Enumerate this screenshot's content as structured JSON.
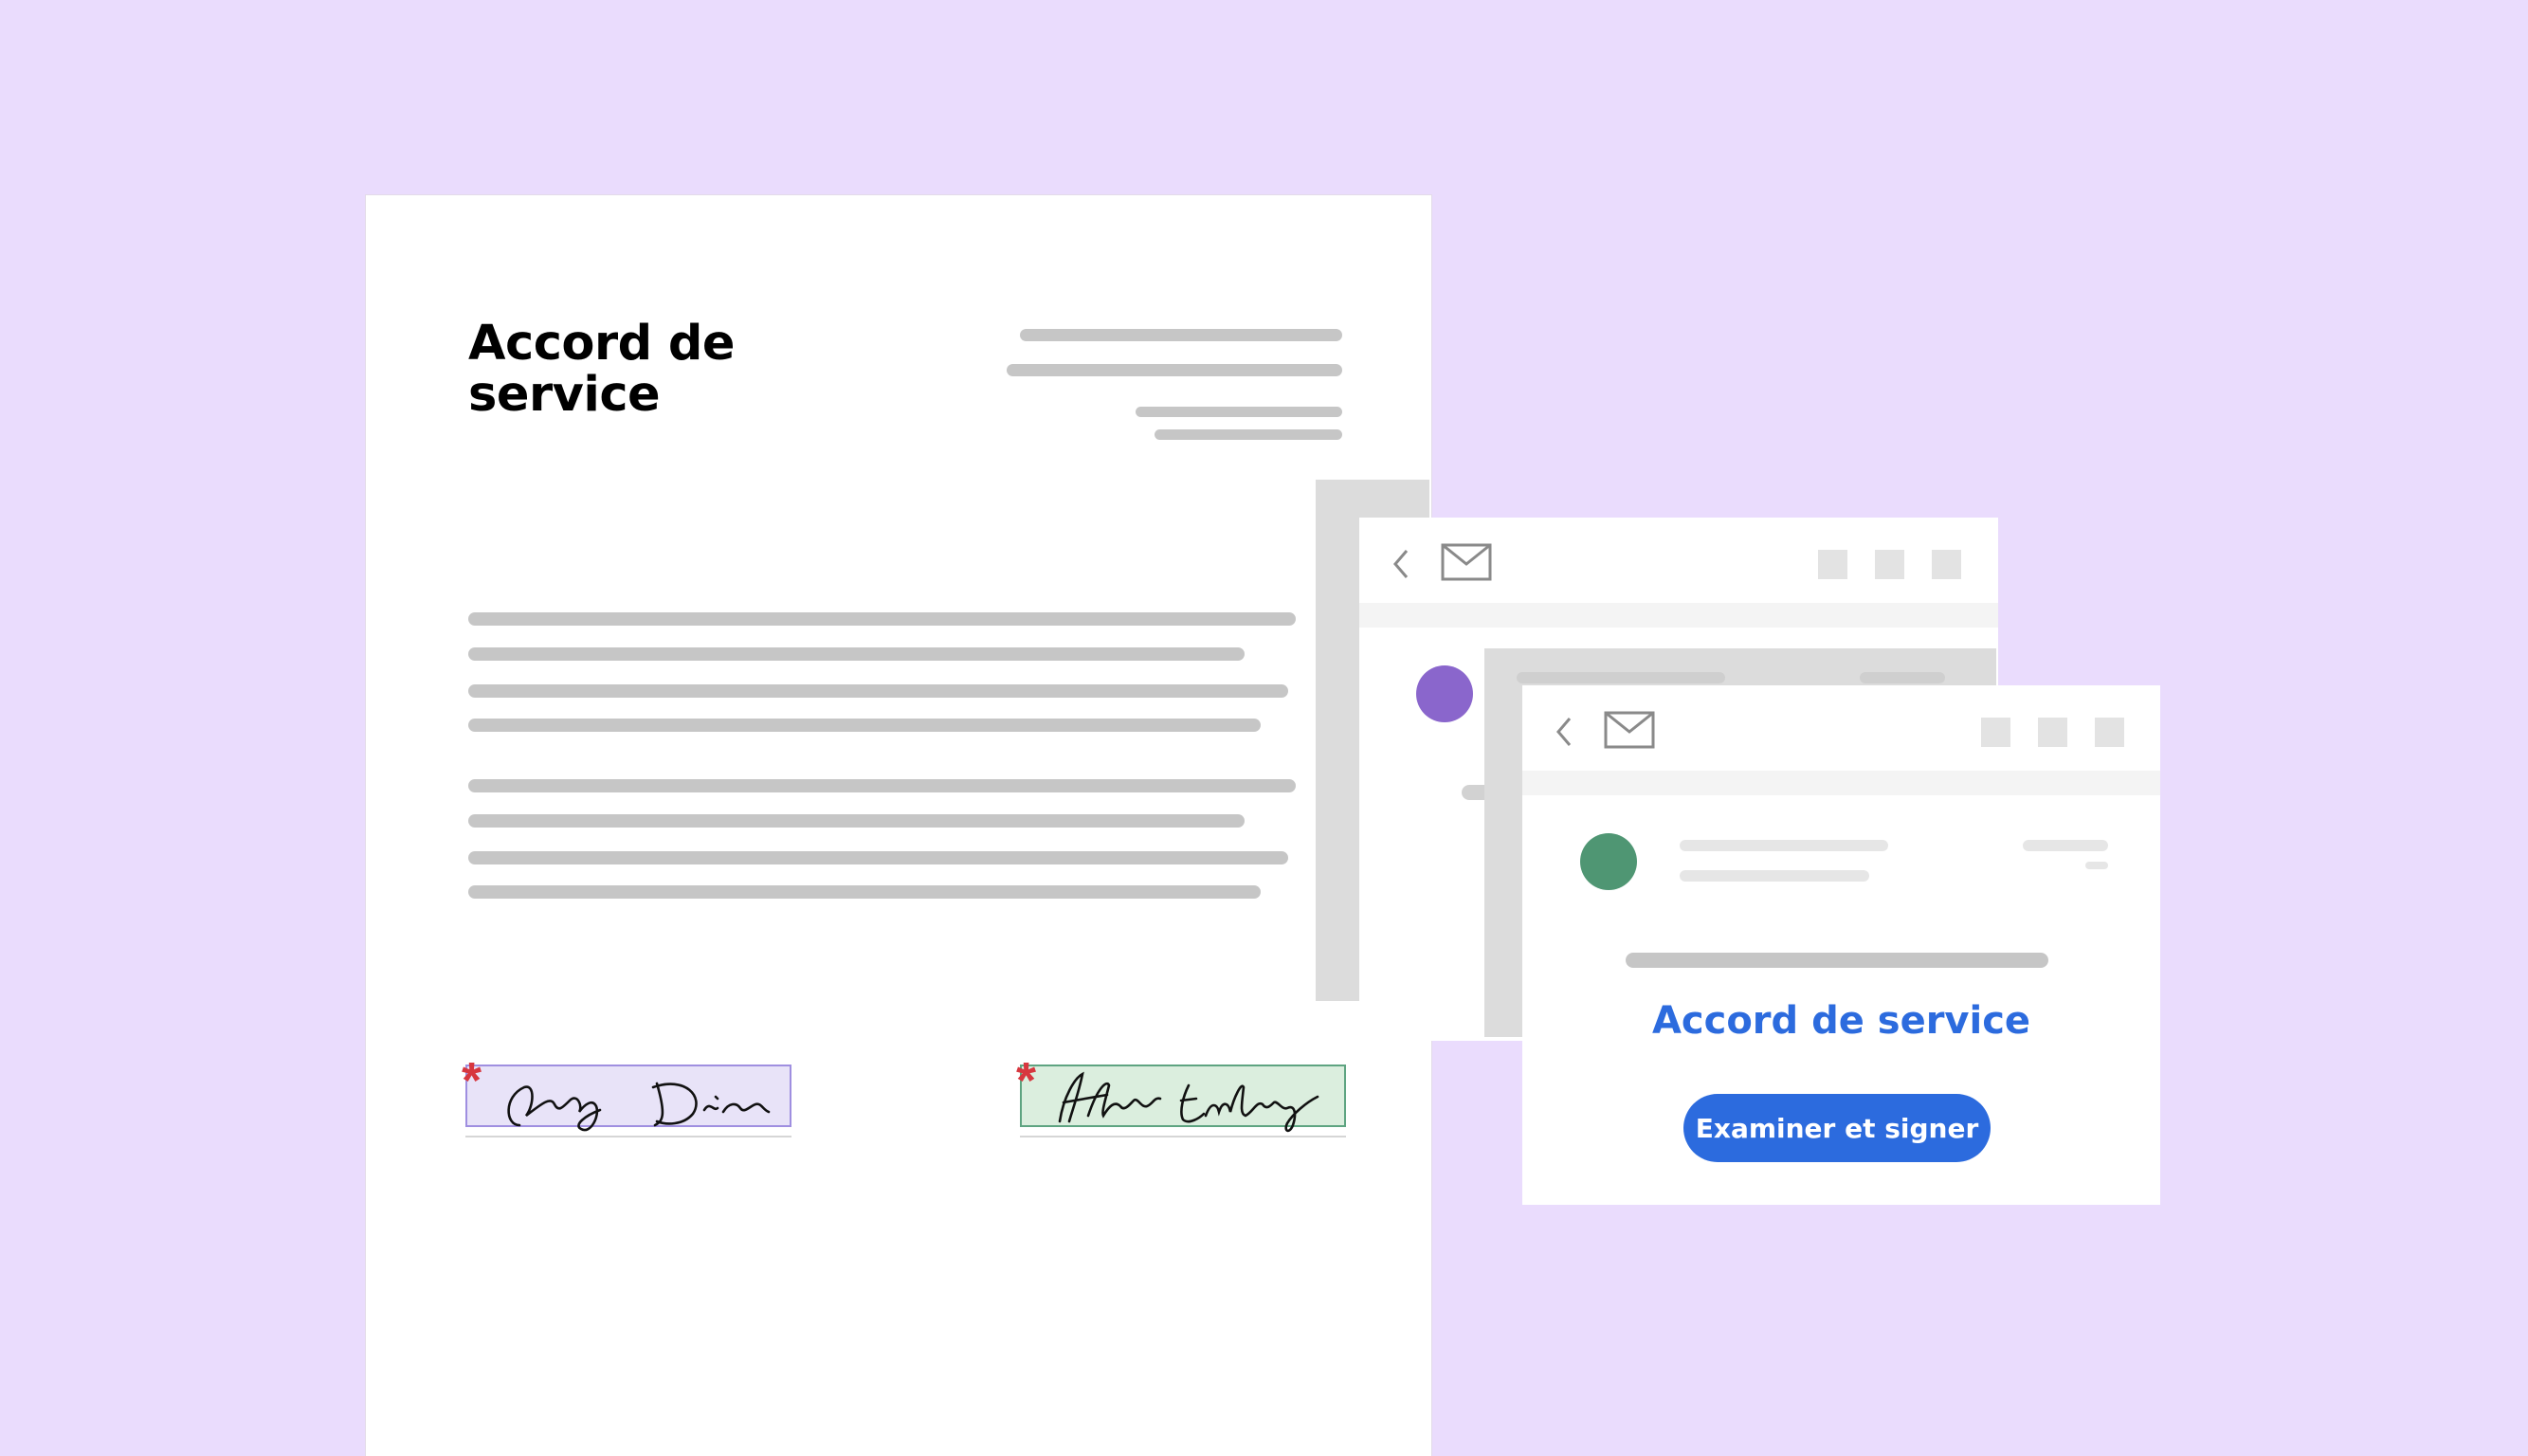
{
  "colors": {
    "background": "#eadcfd",
    "accent_blue": "#2c6bde",
    "asterisk_red": "#d7373f",
    "avatar_purple": "#8a66cc",
    "avatar_green": "#4f9673",
    "signature_box_purple": "#e8e3f8",
    "signature_box_green": "#dbeede"
  },
  "document": {
    "title_line1": "Accord de",
    "title_line2": "service",
    "signature_1": {
      "required_marker": "*"
    },
    "signature_2": {
      "required_marker": "*"
    }
  },
  "email_back": {
    "icons": [
      "chevron-left-icon",
      "mail-icon"
    ]
  },
  "email_front": {
    "icons": [
      "chevron-left-icon",
      "mail-icon"
    ],
    "heading": "Accord de service",
    "button_label": "Examiner et signer"
  }
}
